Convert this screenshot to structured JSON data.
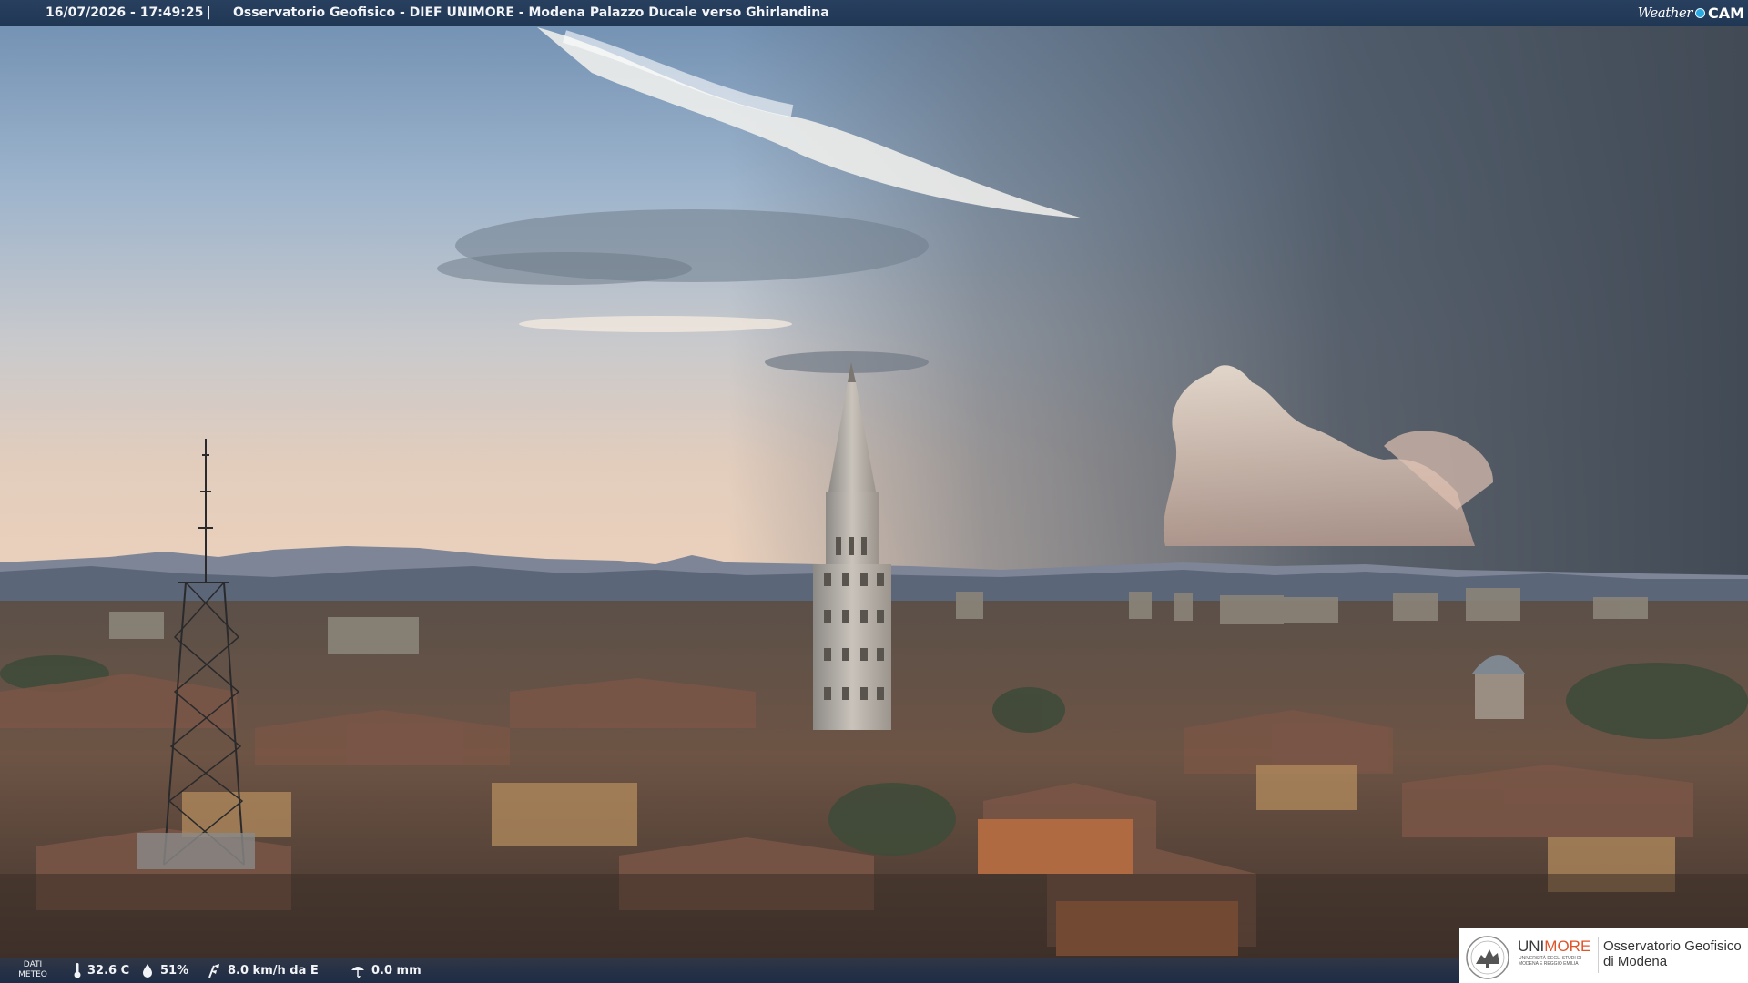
{
  "header": {
    "timestamp": "16/07/2026 - 17:49:25",
    "separator": "|",
    "title": "Osservatorio Geofisico - DIEF UNIMORE - Modena Palazzo Ducale verso Ghirlandina",
    "brand_weather": "Weather",
    "brand_cam": "CAM"
  },
  "weather": {
    "label_line1": "DATI",
    "label_line2": "METEO",
    "temperature": "32.6 C",
    "humidity": "51%",
    "wind": "8.0 km/h da E",
    "rain": "0.0 mm",
    "icons": [
      "thermometer-icon",
      "humidity-drop-icon",
      "wind-icon",
      "rain-icon"
    ]
  },
  "logo": {
    "uni_prefix": "UNI",
    "uni_suffix": "MORE",
    "uni_sub": "UNIVERSITÀ DEGLI STUDI DI MODENA E REGGIO EMILIA",
    "observatory_line1": "Osservatorio Geofisico",
    "observatory_line2": "di Modena",
    "accent_color": "#e0542a"
  },
  "scene": {
    "description_icons": [
      "ghirlandina-tower",
      "antenna-mast",
      "dome",
      "storm-cloud"
    ]
  }
}
